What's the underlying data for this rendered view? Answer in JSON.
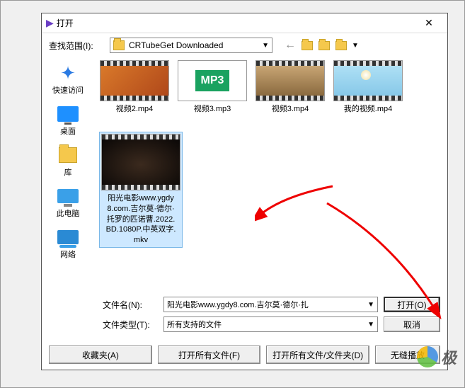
{
  "dialog": {
    "title": "打开",
    "close": "✕",
    "look_in_label": "查找范围(I):",
    "folder_name": "CRTubeGet Downloaded"
  },
  "sidebar": {
    "items": [
      {
        "label": "快速访问"
      },
      {
        "label": "桌面"
      },
      {
        "label": "库"
      },
      {
        "label": "此电脑"
      },
      {
        "label": "网络"
      }
    ]
  },
  "files": {
    "row1": [
      {
        "name": "视频2.mp4"
      },
      {
        "name": "视频3.mp3",
        "mp3_label": "MP3"
      },
      {
        "name": "视频3.mp4"
      },
      {
        "name": "我的视频.mp4"
      }
    ],
    "selected": {
      "name": "阳光电影www.ygdy8.com.吉尔莫·德尔·托罗的匹诺曹.2022.BD.1080P.中英双字.mkv"
    }
  },
  "inputs": {
    "filename_label": "文件名(N):",
    "filename_value": "阳光电影www.ygdy8.com.吉尔莫·德尔·扎",
    "filetype_label": "文件类型(T):",
    "filetype_value": "所有支持的文件",
    "open_btn": "打开(O)",
    "cancel_btn": "取消"
  },
  "footer": {
    "favorites": "收藏夹(A)",
    "open_all_files": "打开所有文件(F)",
    "open_all_folders": "打开所有文件/文件夹(D)",
    "seamless": "无缝播放"
  },
  "watermark": {
    "text": "极"
  }
}
